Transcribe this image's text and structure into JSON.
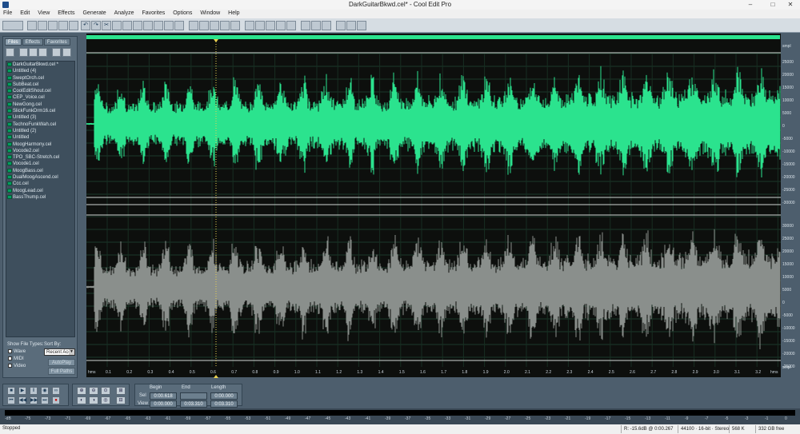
{
  "window": {
    "title": "DarkGuitarBkwd.cel* - Cool Edit Pro",
    "minimize": "–",
    "maximize": "□",
    "close": "✕"
  },
  "menu": [
    "File",
    "Edit",
    "View",
    "Effects",
    "Generate",
    "Analyze",
    "Favorites",
    "Options",
    "Window",
    "Help"
  ],
  "sidebar": {
    "tabs": [
      "Files",
      "Effects",
      "Favorites"
    ],
    "files": [
      "DarkGuitarBkwd.cel *",
      "Untitled (4)",
      "SweptOrch.cel",
      "SubBeat.cel",
      "CoolEditShout.cel",
      "CEP_Voice.cel",
      "NewGong.cel",
      "SlickFunkDrm16.cel",
      "Untitled (3)",
      "TechnoFunkWah.cel",
      "Untitled (2)",
      "Untitled",
      "MoogHarmony.cel",
      "Vocode2.cel",
      "TPO_SBC-Stretch.cel",
      "Vocode1.cel",
      "MoogBass.cel",
      "DualMoogAscend.cel",
      "Ccc.cel",
      "MoogLead.cel",
      "BassThump.cel"
    ],
    "show_file_types_label": "Show File Types:",
    "sort_by_label": "Sort By:",
    "types": [
      "Wave",
      "MIDI",
      "Video"
    ],
    "sort_value": "Recent Acc",
    "autoplay_label": "AutoPlay",
    "full_paths_label": "Full Paths"
  },
  "waveform": {
    "ampl_unit": "smpl",
    "ampl_ticks_top": [
      "25000",
      "20000",
      "15000",
      "10000",
      "5000",
      "0",
      "-5000",
      "-10000",
      "-15000",
      "-20000",
      "-25000",
      "-30000"
    ],
    "ampl_ticks_bottom": [
      "30000",
      "25000",
      "20000",
      "15000",
      "10000",
      "5000",
      "0",
      "-5000",
      "-10000",
      "-15000",
      "-20000",
      "-25000"
    ],
    "ruler_start": "hms",
    "ruler_end": "hms",
    "ruler_ticks": [
      "0.1",
      "0.2",
      "0.3",
      "0.4",
      "0.5",
      "0.6",
      "0.7",
      "0.8",
      "0.9",
      "1.0",
      "1.1",
      "1.2",
      "1.3",
      "1.4",
      "1.5",
      "1.6",
      "1.7",
      "1.8",
      "1.9",
      "2.0",
      "2.1",
      "2.2",
      "2.3",
      "2.4",
      "2.5",
      "2.6",
      "2.7",
      "2.8",
      "2.9",
      "3.0",
      "3.1",
      "3.2"
    ],
    "top_color": "#2be38e",
    "bottom_color": "#8a8f8c"
  },
  "time": {
    "begin_label": "Begin",
    "end_label": "End",
    "length_label": "Length",
    "sel_label": "Sel",
    "view_label": "View",
    "sel_begin": "0:00.618",
    "sel_end": "",
    "sel_length": "0:00.000",
    "view_begin": "0:00.000",
    "view_end": "0:03.310",
    "view_length": "0:03.310"
  },
  "level_scale": [
    "-dB",
    "-75",
    "-73",
    "-71",
    "-69",
    "-67",
    "-65",
    "-63",
    "-61",
    "-59",
    "-57",
    "-55",
    "-53",
    "-51",
    "-49",
    "-47",
    "-45",
    "-43",
    "-41",
    "-39",
    "-37",
    "-35",
    "-33",
    "-31",
    "-29",
    "-27",
    "-25",
    "-23",
    "-21",
    "-19",
    "-17",
    "-15",
    "-13",
    "-11",
    "-9",
    "-7",
    "-5",
    "-3",
    "-1",
    "0"
  ],
  "status": {
    "state": "Stopped",
    "readout": "R: -15.6dB @  0:00.267",
    "format": "44100 · 16-bit · Stereo",
    "size": "568 K",
    "free": "332 GB free"
  }
}
